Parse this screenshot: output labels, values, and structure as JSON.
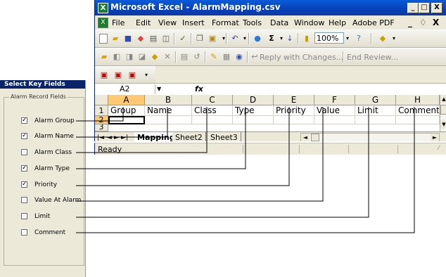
{
  "window": {
    "title": "Microsoft Excel - AlarmMapping.csv",
    "controls": [
      "_",
      "□",
      "X"
    ]
  },
  "menu": {
    "items": [
      "File",
      "Edit",
      "View",
      "Insert",
      "Format",
      "Tools",
      "Data",
      "Window",
      "Help",
      "Adobe PDF"
    ],
    "mdi_controls": [
      "_",
      "♢",
      "X"
    ]
  },
  "toolbar": {
    "zoom": "100%",
    "reply_with_changes": "Reply with Changes...",
    "end_review": "End Review..."
  },
  "formula_bar": {
    "name_box": "A2",
    "fx": "fx",
    "content": ""
  },
  "sheet": {
    "columns": [
      "A",
      "B",
      "C",
      "D",
      "E",
      "F",
      "G",
      "H"
    ],
    "rows": [
      "1",
      "2",
      "3"
    ],
    "header_row": [
      "Group",
      "Name",
      "Class",
      "Type",
      "Priority",
      "Value",
      "Limit",
      "Comment"
    ],
    "active_cell": "A2"
  },
  "tabs": {
    "nav_buttons": [
      "|◄",
      "◄",
      "►",
      "►|"
    ],
    "sheets": [
      "Mapping",
      "Sheet2",
      "Sheet3"
    ],
    "active": "Mapping"
  },
  "status": {
    "text": "Ready"
  },
  "dialog": {
    "title": "Select Key Fields",
    "group_label": "Alarm Record Fields",
    "fields": [
      {
        "label": "Alarm Group",
        "checked": true,
        "check": "✓"
      },
      {
        "label": "Alarm Name",
        "checked": true,
        "check": "✓"
      },
      {
        "label": "Alarm Class",
        "checked": false,
        "check": ""
      },
      {
        "label": "Alarm Type",
        "checked": true,
        "check": "✓"
      },
      {
        "label": "Priority",
        "checked": true,
        "check": "✓"
      },
      {
        "label": "Value At Alarm",
        "checked": false,
        "check": ""
      },
      {
        "label": "Limit",
        "checked": false,
        "check": ""
      },
      {
        "label": "Comment",
        "checked": false,
        "check": ""
      }
    ]
  },
  "colors": {
    "title_blue": "#0a5bd8",
    "dialog_title": "#0a246a",
    "selected_header": "#ffc873",
    "chrome": "#ece9d8"
  }
}
